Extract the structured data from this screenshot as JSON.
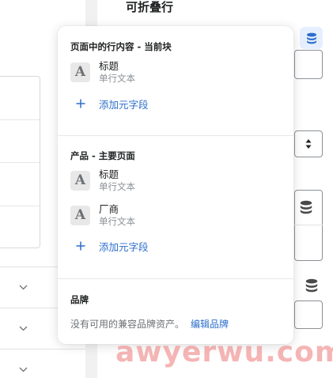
{
  "background": {
    "right_title": "可折叠行"
  },
  "popover": {
    "sections": [
      {
        "title": "页面中的行内容 - 当前块",
        "fields": [
          {
            "icon": "A",
            "name": "标题",
            "type": "单行文本"
          }
        ],
        "add_label": "添加元字段"
      },
      {
        "title": "产品 - 主要页面",
        "fields": [
          {
            "icon": "A",
            "name": "标题",
            "type": "单行文本"
          },
          {
            "icon": "A",
            "name": "厂商",
            "type": "单行文本"
          }
        ],
        "add_label": "添加元字段"
      }
    ],
    "brand": {
      "title": "品牌",
      "message": "没有可用的兼容品牌资产。",
      "link": "编辑品牌"
    }
  },
  "watermark": "awyerwu.com",
  "colors": {
    "link": "#2c6ecb",
    "accent_bg": "#e6efff",
    "icon_bg": "#e8e8e8"
  }
}
